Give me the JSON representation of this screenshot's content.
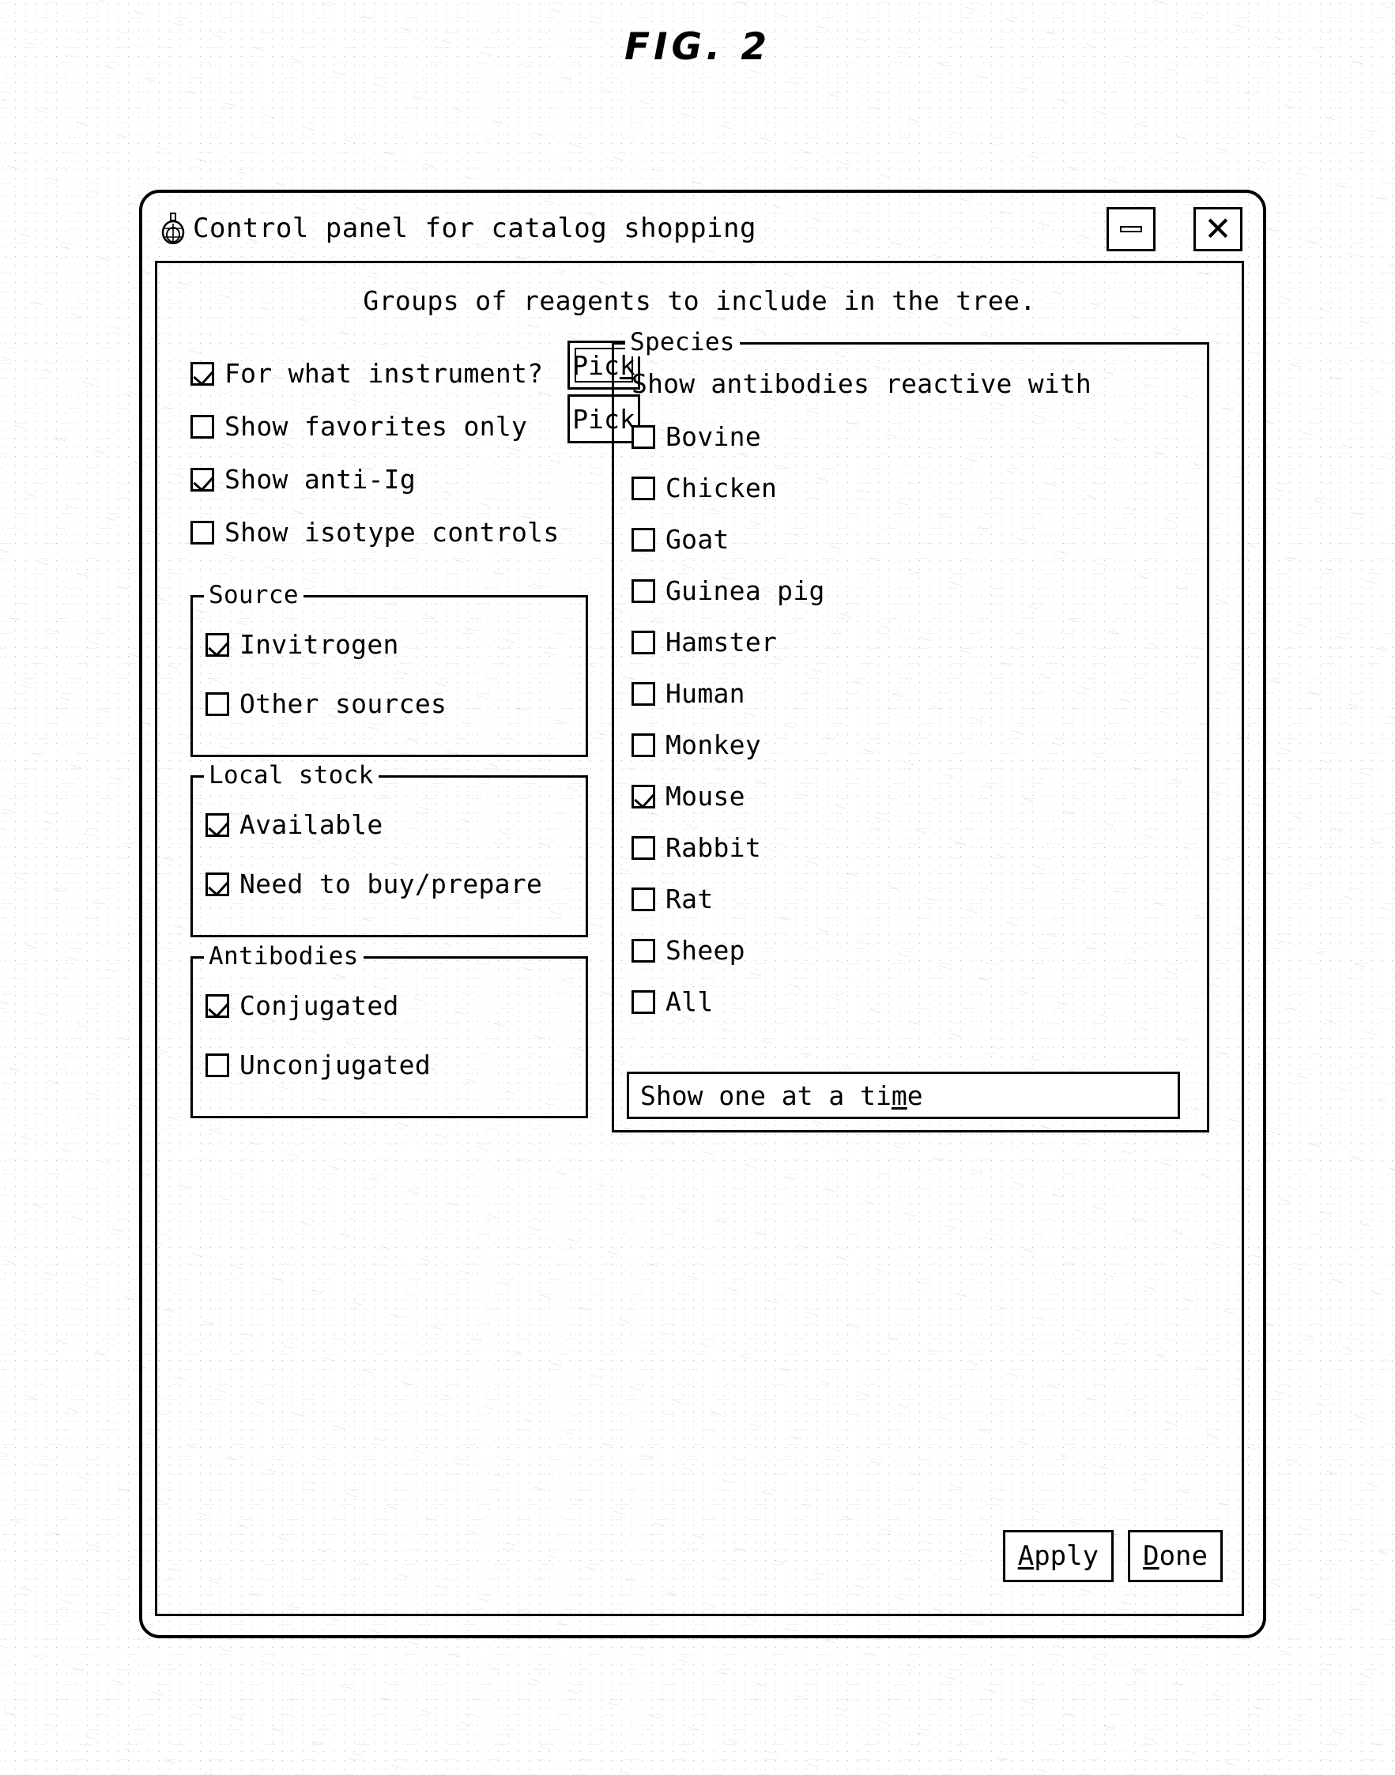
{
  "figure": {
    "label": "FIG. 2"
  },
  "window": {
    "title": "Control panel for catalog shopping",
    "icon": "app-globe-icon",
    "minimize_label": "",
    "close_label": "✕"
  },
  "headline": "Groups of reagents to include in the tree.",
  "top_options": [
    {
      "label": "For what instrument?",
      "checked": true,
      "button": {
        "label_pre": "Pic",
        "label_accel": "k",
        "label_post": "",
        "focused": true
      }
    },
    {
      "label": "Show favorites only",
      "checked": false,
      "button": {
        "label_pre": "Pick",
        "label_accel": "",
        "label_post": "",
        "focused": false
      }
    },
    {
      "label": "Show anti-Ig",
      "checked": true
    },
    {
      "label": "Show isotype controls",
      "checked": false
    }
  ],
  "groups": [
    {
      "title": "Source",
      "items": [
        {
          "label": "Invitrogen",
          "checked": true
        },
        {
          "label": "Other sources",
          "checked": false
        }
      ]
    },
    {
      "title": "Local stock",
      "items": [
        {
          "label": "Available",
          "checked": true
        },
        {
          "label": "Need to buy/prepare",
          "checked": true
        }
      ]
    },
    {
      "title": "Antibodies",
      "items": [
        {
          "label": "Conjugated",
          "checked": true
        },
        {
          "label": "Unconjugated",
          "checked": false
        }
      ]
    }
  ],
  "species": {
    "title": "Species",
    "note": "Show antibodies reactive with",
    "items": [
      {
        "label": "Bovine",
        "checked": false
      },
      {
        "label": "Chicken",
        "checked": false
      },
      {
        "label": "Goat",
        "checked": false
      },
      {
        "label": "Guinea pig",
        "checked": false
      },
      {
        "label": "Hamster",
        "checked": false
      },
      {
        "label": "Human",
        "checked": false
      },
      {
        "label": "Monkey",
        "checked": false
      },
      {
        "label": "Mouse",
        "checked": true
      },
      {
        "label": "Rabbit",
        "checked": false
      },
      {
        "label": "Rat",
        "checked": false
      },
      {
        "label": "Sheep",
        "checked": false
      },
      {
        "label": "All",
        "checked": false
      }
    ],
    "show_one_button": {
      "label_pre": "Show one at a ti",
      "label_accel": "m",
      "label_post": "e"
    }
  },
  "actions": [
    {
      "label_pre": "",
      "label_accel": "A",
      "label_post": "pply"
    },
    {
      "label_pre": "",
      "label_accel": "D",
      "label_post": "one"
    }
  ]
}
